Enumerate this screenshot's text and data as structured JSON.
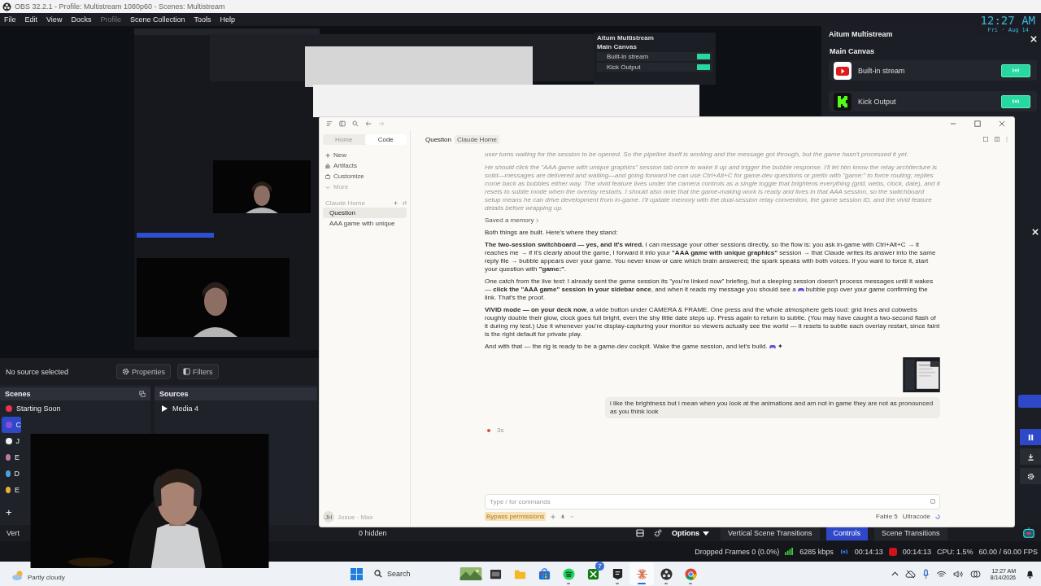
{
  "title_bar": {
    "title": "OBS 32.2.1 - Profile: Multistream 1080p60 - Scenes: Multistream"
  },
  "menu": [
    {
      "label": "File",
      "disabled": false
    },
    {
      "label": "Edit",
      "disabled": false
    },
    {
      "label": "View",
      "disabled": false
    },
    {
      "label": "Docks",
      "disabled": false
    },
    {
      "label": "Profile",
      "disabled": true
    },
    {
      "label": "Scene Collection",
      "disabled": false
    },
    {
      "label": "Tools",
      "disabled": false
    },
    {
      "label": "Help",
      "disabled": false
    }
  ],
  "overlay_clock": {
    "time": "12:27 AM",
    "date": "Fri · Aug 14"
  },
  "preview": {
    "mini_dock": {
      "title": "Altum Multistream",
      "section": "Main Canvas",
      "outputs": [
        "Built-in stream",
        "Kick Output"
      ]
    }
  },
  "source_toolbar": {
    "label": "No source selected",
    "buttons": [
      {
        "label": "Properties",
        "kind": "gear"
      },
      {
        "label": "Filters",
        "kind": "filter"
      }
    ]
  },
  "scenes": {
    "title": "Scenes",
    "items": [
      {
        "name": "Starting Soon",
        "selected": false,
        "color": "#e8344e"
      },
      {
        "name": "C",
        "selected": true,
        "color": "#8a4fd6"
      },
      {
        "name": "J",
        "selected": false,
        "color": "#eeeeee"
      },
      {
        "name": "E",
        "selected": false,
        "color": "#c07a9a"
      },
      {
        "name": "D",
        "selected": false,
        "color": "#4aa3df"
      },
      {
        "name": "E",
        "selected": false,
        "color": "#e8b23a"
      }
    ],
    "add": "+",
    "footer": "Vert"
  },
  "sources": {
    "title": "Sources",
    "items": [
      {
        "name": "Media 4"
      }
    ]
  },
  "aitum": {
    "title": "Aitum Multistream",
    "section": "Main Canvas",
    "outputs": [
      {
        "name": "Built-in stream",
        "kind": "youtube"
      },
      {
        "name": "Kick Output",
        "kind": "kick"
      }
    ]
  },
  "claude": {
    "sidebar": {
      "modes": [
        {
          "label": "Home",
          "selected": false
        },
        {
          "label": "Code",
          "selected": true
        }
      ],
      "nav": [
        {
          "label": "New",
          "kind": "plus"
        },
        {
          "label": "Artifacts",
          "kind": "shapes"
        },
        {
          "label": "Customize",
          "kind": "case"
        },
        {
          "label": "More",
          "kind": "chevron"
        }
      ],
      "section": "Claude Home",
      "chats": [
        {
          "label": "Question",
          "selected": true
        },
        {
          "label": "AAA game with unique",
          "selected": false
        }
      ],
      "user": {
        "initials": "JH",
        "name": "Josue · Max"
      }
    },
    "header": {
      "title": "Question",
      "tag": "Claude Home"
    },
    "messages": [
      {
        "kind": "thinking",
        "parts": [
          "user turns waiting for the session to be opened. So the pipeline itself is working and the message got through, but the game hasn't processed it yet."
        ]
      },
      {
        "kind": "thinking",
        "parts": [
          "He should click the \"AAA game with unique graphics\" session tab once to wake it up and trigger the bubble response. I'll let him know the relay architecture is solid—messages are delivered and waiting—and going forward he can use Ctrl+Alt+C for game-dev questions or prefix with \"game:\" to force routing; replies come back as bubbles either way. The vivid feature lives under the camera controls as a single toggle that brightens everything (grid, webs, clock, date), and it resets to subtle mode when the overlay restarts. I should also note that the game-making work is ready and lives in that AAA session, so the switchboard setup means he can drive development from in-game. I'll update memory with the dual-session relay convention, the game session ID, and the vivid feature details before wrapping up."
        ]
      },
      {
        "kind": "memory",
        "parts": [
          "Saved a memory"
        ]
      },
      {
        "kind": "text",
        "parts": [
          "Both things are built. Here's where they stand:"
        ]
      },
      {
        "kind": "text",
        "parts": [
          "**The two-session switchboard — yes, and it's wired.** I can message your other sessions directly, so the flow is: you ask in-game with Ctrl+Alt+C → it reaches me → if it's clearly about the game, I forward it into your **\"AAA game with unique graphics\"** session → that Claude writes its answer into the same reply file → bubble appears over your game. You never know or care which brain answered; the spark speaks with both voices. If you want to force it, start your question with **\"game:\"**."
        ]
      },
      {
        "kind": "text",
        "parts": [
          "One catch from the live test: I already sent the game session its \"you're linked now\" briefing, but a sleeping session doesn't process messages until it wakes — **click the \"AAA game\" session in your sidebar once**, and when it reads my message you should see a ",
          "bubble pop over your game confirming the link. That's the proof."
        ]
      },
      {
        "kind": "text",
        "parts": [
          "**VIVID mode — on your deck now**, a wide button under CAMERA & FRAME. One press and the whole atmosphere gets loud: grid lines and cobwebs roughly double their glow, clock goes full bright, even the shy little date steps up. Press again to return to subtle. (You may have caught a two-second flash of it during my test.) Use it whenever you're display-capturing your monitor so viewers actually see the world — it resets to subtle each overlay restart, since faint is the right default for private play."
        ]
      },
      {
        "kind": "text",
        "parts": [
          "And with that — the rig is ready to be a game-dev cockpit. Wake the game session, and let's build. ",
          "✦"
        ]
      }
    ],
    "user_message": "i like the brightness but i mean when you look at the animations and am not in game they are not as pronounced as you think look",
    "progress": {
      "elapsed": "3s"
    },
    "input": {
      "placeholder": "Type / for commands"
    },
    "footer": {
      "mode": "Bypass permissions",
      "model": "Fable 5",
      "effort": "Ultracode"
    }
  },
  "dock_bar": {
    "hidden": "0 hidden",
    "options": "Options",
    "tabs": [
      {
        "label": "Vertical Scene Transitions",
        "selected": false
      },
      {
        "label": "Controls",
        "selected": true
      },
      {
        "label": "Scene Transitions",
        "selected": false
      }
    ]
  },
  "status_bar": {
    "dropped": "Dropped Frames 0 (0.0%)",
    "kbps": "6285 kbps",
    "stream_time": "00:14:13",
    "rec_time": "00:14:13",
    "cpu": "CPU: 1.5%",
    "fps": "60.00 / 60.00 FPS"
  },
  "taskbar": {
    "weather": "Partly cloudy",
    "search": "Search",
    "apps": [
      {
        "kind": "widgets",
        "active": false,
        "running": false
      },
      {
        "kind": "terminal",
        "active": false,
        "running": false
      },
      {
        "kind": "folder",
        "active": false,
        "running": false
      },
      {
        "kind": "store",
        "active": false,
        "running": false
      },
      {
        "kind": "music",
        "active": false,
        "running": true
      },
      {
        "kind": "xbox",
        "active": false,
        "running": false,
        "badge": "7"
      },
      {
        "kind": "epic",
        "active": false,
        "running": true
      },
      {
        "kind": "claude",
        "active": true,
        "running": true
      },
      {
        "kind": "obs",
        "active": false,
        "running": true
      },
      {
        "kind": "chrome",
        "active": false,
        "running": true
      }
    ],
    "time": "12:27 AM",
    "date": "8/14/2026"
  }
}
